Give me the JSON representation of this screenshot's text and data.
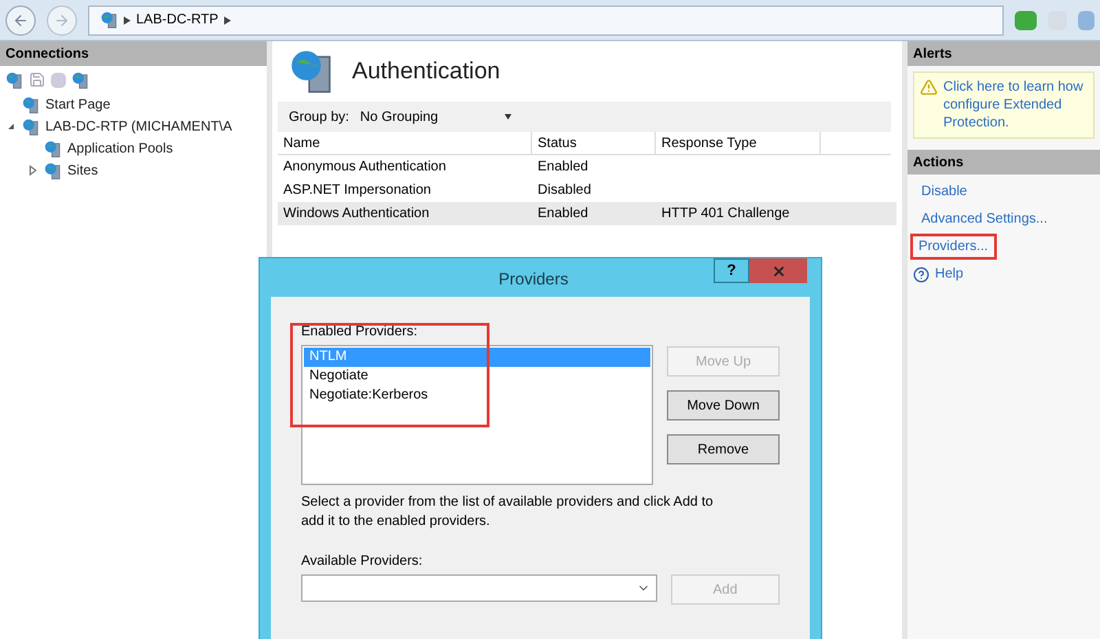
{
  "address_bar": {
    "path": "LAB-DC-RTP"
  },
  "connections": {
    "title": "Connections",
    "tree": [
      {
        "label": "Start Page"
      },
      {
        "label": "LAB-DC-RTP (MICHAMENT\\A",
        "expanded": true,
        "children": [
          {
            "label": "Application Pools"
          },
          {
            "label": "Sites",
            "expanded": false
          }
        ]
      }
    ]
  },
  "feature": {
    "title": "Authentication",
    "group_by_label": "Group by:",
    "group_by_value": "No Grouping",
    "columns": [
      "Name",
      "Status",
      "Response Type"
    ],
    "rows": [
      {
        "name": "Anonymous Authentication",
        "status": "Enabled",
        "selected": false
      },
      {
        "name": "ASP.NET Impersonation",
        "status": "Disabled",
        "selected": false
      },
      {
        "name": "Windows Authentication",
        "status": "Enabled",
        "response_type": "HTTP 401 Challenge",
        "selected": true
      }
    ]
  },
  "alerts": {
    "title": "Alerts",
    "message_lines": [
      "Click here to learn how",
      "configure Extended",
      "Protection."
    ]
  },
  "actions": {
    "title": "Actions",
    "items": [
      {
        "kind": "link",
        "label": "Disable",
        "highlighted": false
      },
      {
        "kind": "link",
        "label": "Advanced Settings...",
        "highlighted": false
      },
      {
        "kind": "link",
        "label": "Providers...",
        "highlighted": true
      },
      {
        "kind": "help",
        "label": "Help",
        "highlighted": false
      }
    ]
  },
  "dialog": {
    "title": "Providers",
    "help_label": "?",
    "enabled_label": "Enabled Providers:",
    "enabled_highlighted": true,
    "enabled_providers": [
      {
        "label": "NTLM",
        "selected": true
      },
      {
        "label": "Negotiate",
        "selected": false
      },
      {
        "label": "Negotiate:Kerberos",
        "selected": false
      }
    ],
    "buttons": [
      {
        "label": "Move Up",
        "disabled": true
      },
      {
        "label": "Move Down",
        "disabled": false
      },
      {
        "label": "Remove",
        "disabled": false
      }
    ],
    "hint": "Select a provider from the list of available providers and click Add to add it to the enabled providers.",
    "available_label": "Available Providers:",
    "add_button": {
      "label": "Add",
      "disabled": true
    }
  }
}
